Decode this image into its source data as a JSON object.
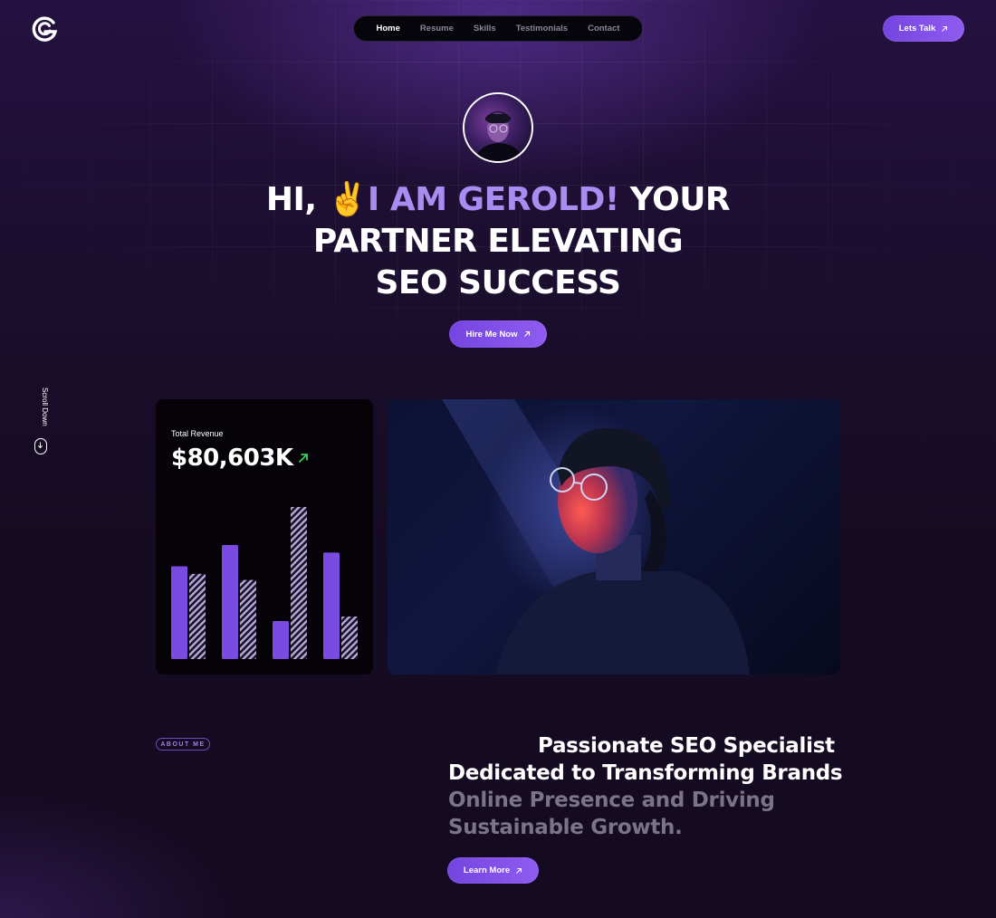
{
  "brand": {
    "logo_icon": "g-logo-icon"
  },
  "nav": {
    "items": [
      {
        "label": "Home",
        "active": true
      },
      {
        "label": "Resume",
        "active": false
      },
      {
        "label": "Skills",
        "active": false
      },
      {
        "label": "Testimonials",
        "active": false
      },
      {
        "label": "Contact",
        "active": false
      }
    ],
    "cta_label": "Lets Talk",
    "cta_icon": "arrow-up-right-icon"
  },
  "hero": {
    "avatar": "profile-avatar",
    "line1_prefix": "HI, ",
    "emoji": "✌️",
    "line1_accent": "I AM GEROLD!",
    "line1_suffix": " YOUR",
    "line2": "PARTNER ELEVATING",
    "line3": "SEO SUCCESS",
    "cta_label": "Hire Me Now"
  },
  "scroll": {
    "label": "Scroll Down",
    "icon": "mouse-icon"
  },
  "revenue": {
    "label": "Total Revenue",
    "value": "$80,603K",
    "trend_icon": "arrow-up-right-icon",
    "trend_color": "#2fd15f"
  },
  "chart_data": {
    "type": "bar",
    "categories": [
      "1",
      "2",
      "3",
      "4"
    ],
    "series": [
      {
        "values": [
          0.61,
          0.75,
          0.25,
          0.7
        ],
        "style": "solid"
      },
      {
        "values": [
          0.56,
          0.52,
          1.0,
          0.28
        ],
        "style": "hatched"
      }
    ],
    "ylim": [
      0,
      1
    ],
    "grid": false,
    "colors": {
      "solid": "#7a4be0",
      "hatched": "#b7a8dd"
    }
  },
  "about": {
    "badge": "ABOUT ME",
    "line1": "Passionate SEO Specialist",
    "line2": "Dedicated to Transforming Brands",
    "line3": "Online Presence and Driving",
    "line4": "Sustainable Growth.",
    "cta_label": "Learn More"
  },
  "colors": {
    "accent": "#7b4ae2",
    "accent_text": "#a98cf0",
    "background": "#150b22",
    "muted_text": "#7b7387"
  }
}
